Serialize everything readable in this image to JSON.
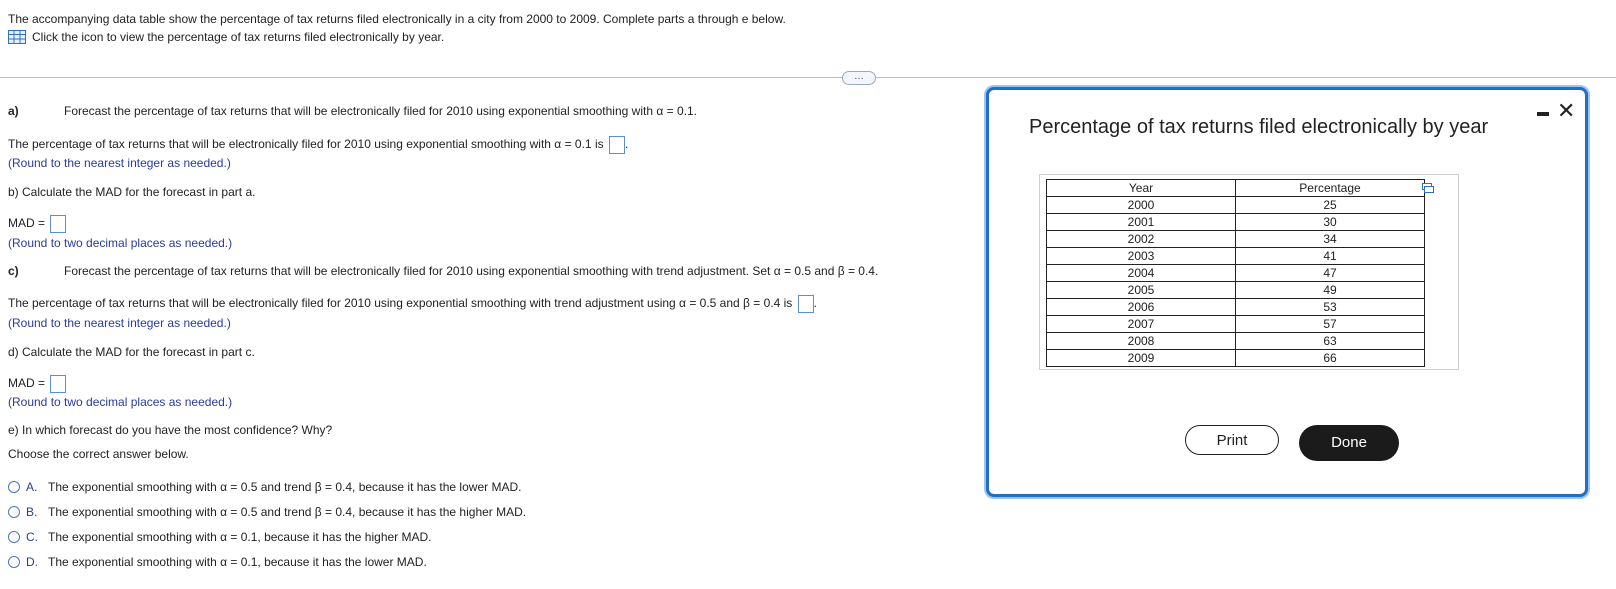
{
  "intro": {
    "line1": "The accompanying data table show the percentage of tax returns filed electronically in a city from 2000 to 2009. Complete parts a through e below.",
    "line2": "Click the icon to view the percentage of tax returns filed electronically by year."
  },
  "divider_button": "…",
  "part_a": {
    "label": "a)",
    "prompt": "Forecast the percentage of tax returns that will be electronically filed for 2010 using exponential smoothing with α = 0.1.",
    "answer_text": "The percentage of tax returns that will be electronically filed for 2010 using exponential smoothing with α = 0.1 is",
    "hint": "(Round to the nearest integer as needed.)"
  },
  "part_b": {
    "prompt": "b) Calculate the MAD for the forecast in part a.",
    "answer_label": "MAD =",
    "hint": "(Round to two decimal places as needed.)"
  },
  "part_c": {
    "label": "c)",
    "prompt": "Forecast the percentage of tax returns that will be electronically filed for 2010 using exponential smoothing with trend adjustment. Set α = 0.5 and β = 0.4.",
    "answer_text": "The percentage of tax returns that will be electronically filed for 2010 using exponential smoothing with trend adjustment using α = 0.5 and β = 0.4 is",
    "hint": "(Round to the nearest integer as needed.)"
  },
  "part_d": {
    "prompt": "d) Calculate the MAD for the forecast in part c.",
    "answer_label": "MAD =",
    "hint": "(Round to two decimal places as needed.)"
  },
  "part_e": {
    "prompt": "e) In which forecast do you have the most confidence? Why?",
    "instruction": "Choose the correct answer below.",
    "options": [
      {
        "letter": "A.",
        "text": "The exponential smoothing with α = 0.5 and trend β = 0.4, because it has the lower MAD."
      },
      {
        "letter": "B.",
        "text": "The exponential smoothing with α = 0.5 and trend β = 0.4, because it has the higher MAD."
      },
      {
        "letter": "C.",
        "text": "The exponential smoothing with α = 0.1, because it has the higher MAD."
      },
      {
        "letter": "D.",
        "text": "The exponential smoothing with α = 0.1, because it has the lower MAD."
      }
    ]
  },
  "dialog": {
    "title": "Percentage of tax returns filed electronically by year",
    "table": {
      "headers": [
        "Year",
        "Percentage"
      ],
      "rows": [
        [
          "2000",
          "25"
        ],
        [
          "2001",
          "30"
        ],
        [
          "2002",
          "34"
        ],
        [
          "2003",
          "41"
        ],
        [
          "2004",
          "47"
        ],
        [
          "2005",
          "49"
        ],
        [
          "2006",
          "53"
        ],
        [
          "2007",
          "57"
        ],
        [
          "2008",
          "63"
        ],
        [
          "2009",
          "66"
        ]
      ]
    },
    "print_label": "Print",
    "done_label": "Done"
  },
  "colors": {
    "accent": "#1f6fc7",
    "hint": "#2a3b9b",
    "done_bg": "#1b1b1b"
  }
}
